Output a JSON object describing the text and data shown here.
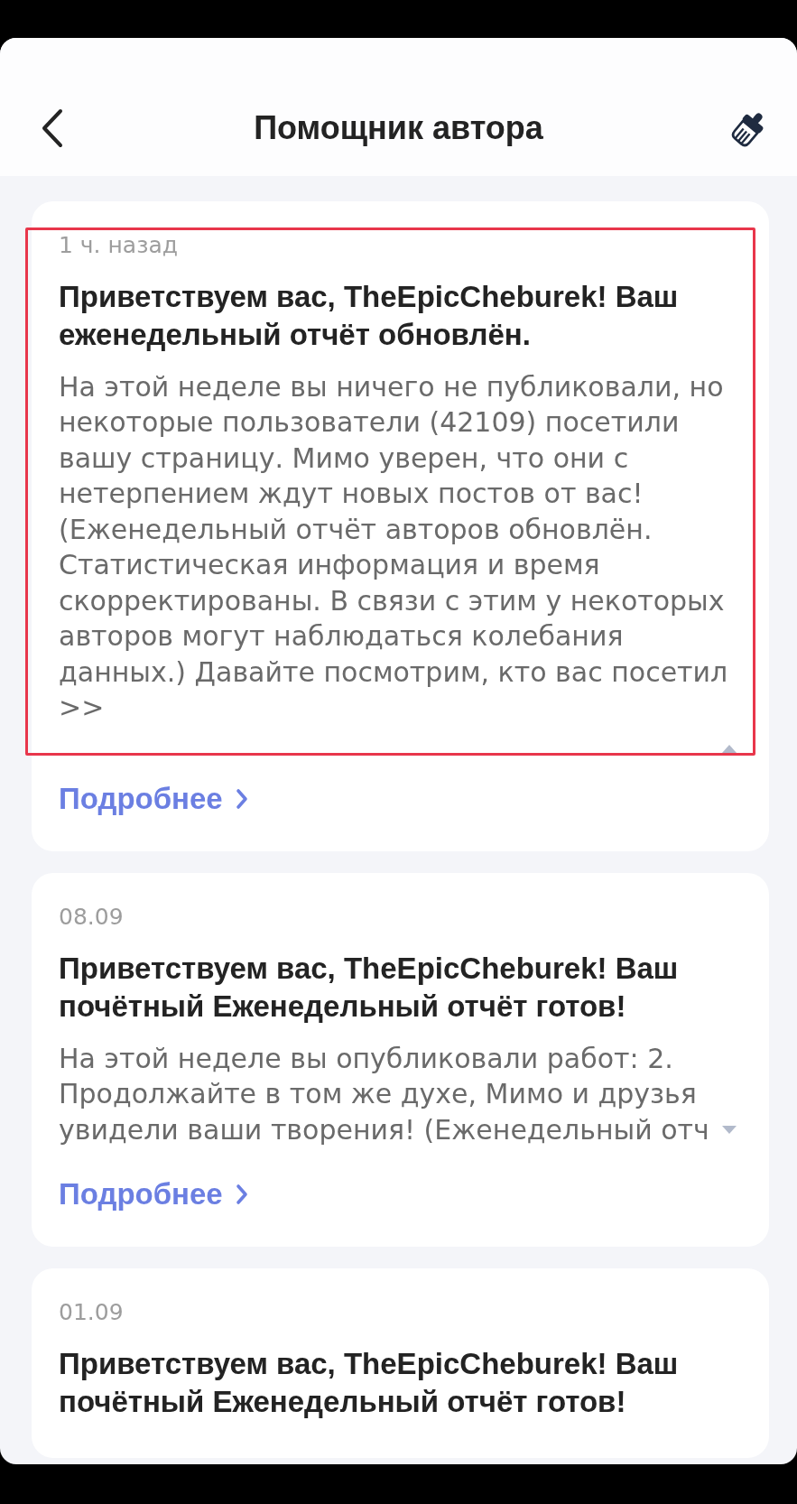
{
  "header": {
    "title": "Помощник автора"
  },
  "notifications": [
    {
      "time": "1 ч. назад",
      "title": "Приветствуем вас, TheEpicCheburek! Ваш еженедельный отчёт обновлён.",
      "body": "На этой неделе вы ничего не публиковали, но некоторые пользователи (42109) посетили вашу страницу. Мимо уверен, что они с нетерпением ждут новых постов от вас! (Еженедельный отчёт авторов обновлён. Статистическая информация и время скорректированы. В связи с этим у некоторых авторов могут наблюдаться колебания данных.) Давайте посмотрим, кто вас посетил >>",
      "expanded": true,
      "highlighted": true,
      "link": "Подробнее"
    },
    {
      "time": "08.09",
      "title": "Приветствуем вас, TheEpicCheburek! Ваш почётный Еженедельный отчёт готов!",
      "body": "На этой неделе вы опубликовали работ: 2. Продолжайте в том же духе, Мимо и друзья увидели ваши творения! (Еженедельный отч",
      "expanded": false,
      "highlighted": false,
      "link": "Подробнее"
    },
    {
      "time": "01.09",
      "title": "Приветствуем вас, TheEpicCheburek! Ваш почётный Еженедельный отчёт готов!",
      "highlighted": false
    }
  ]
}
